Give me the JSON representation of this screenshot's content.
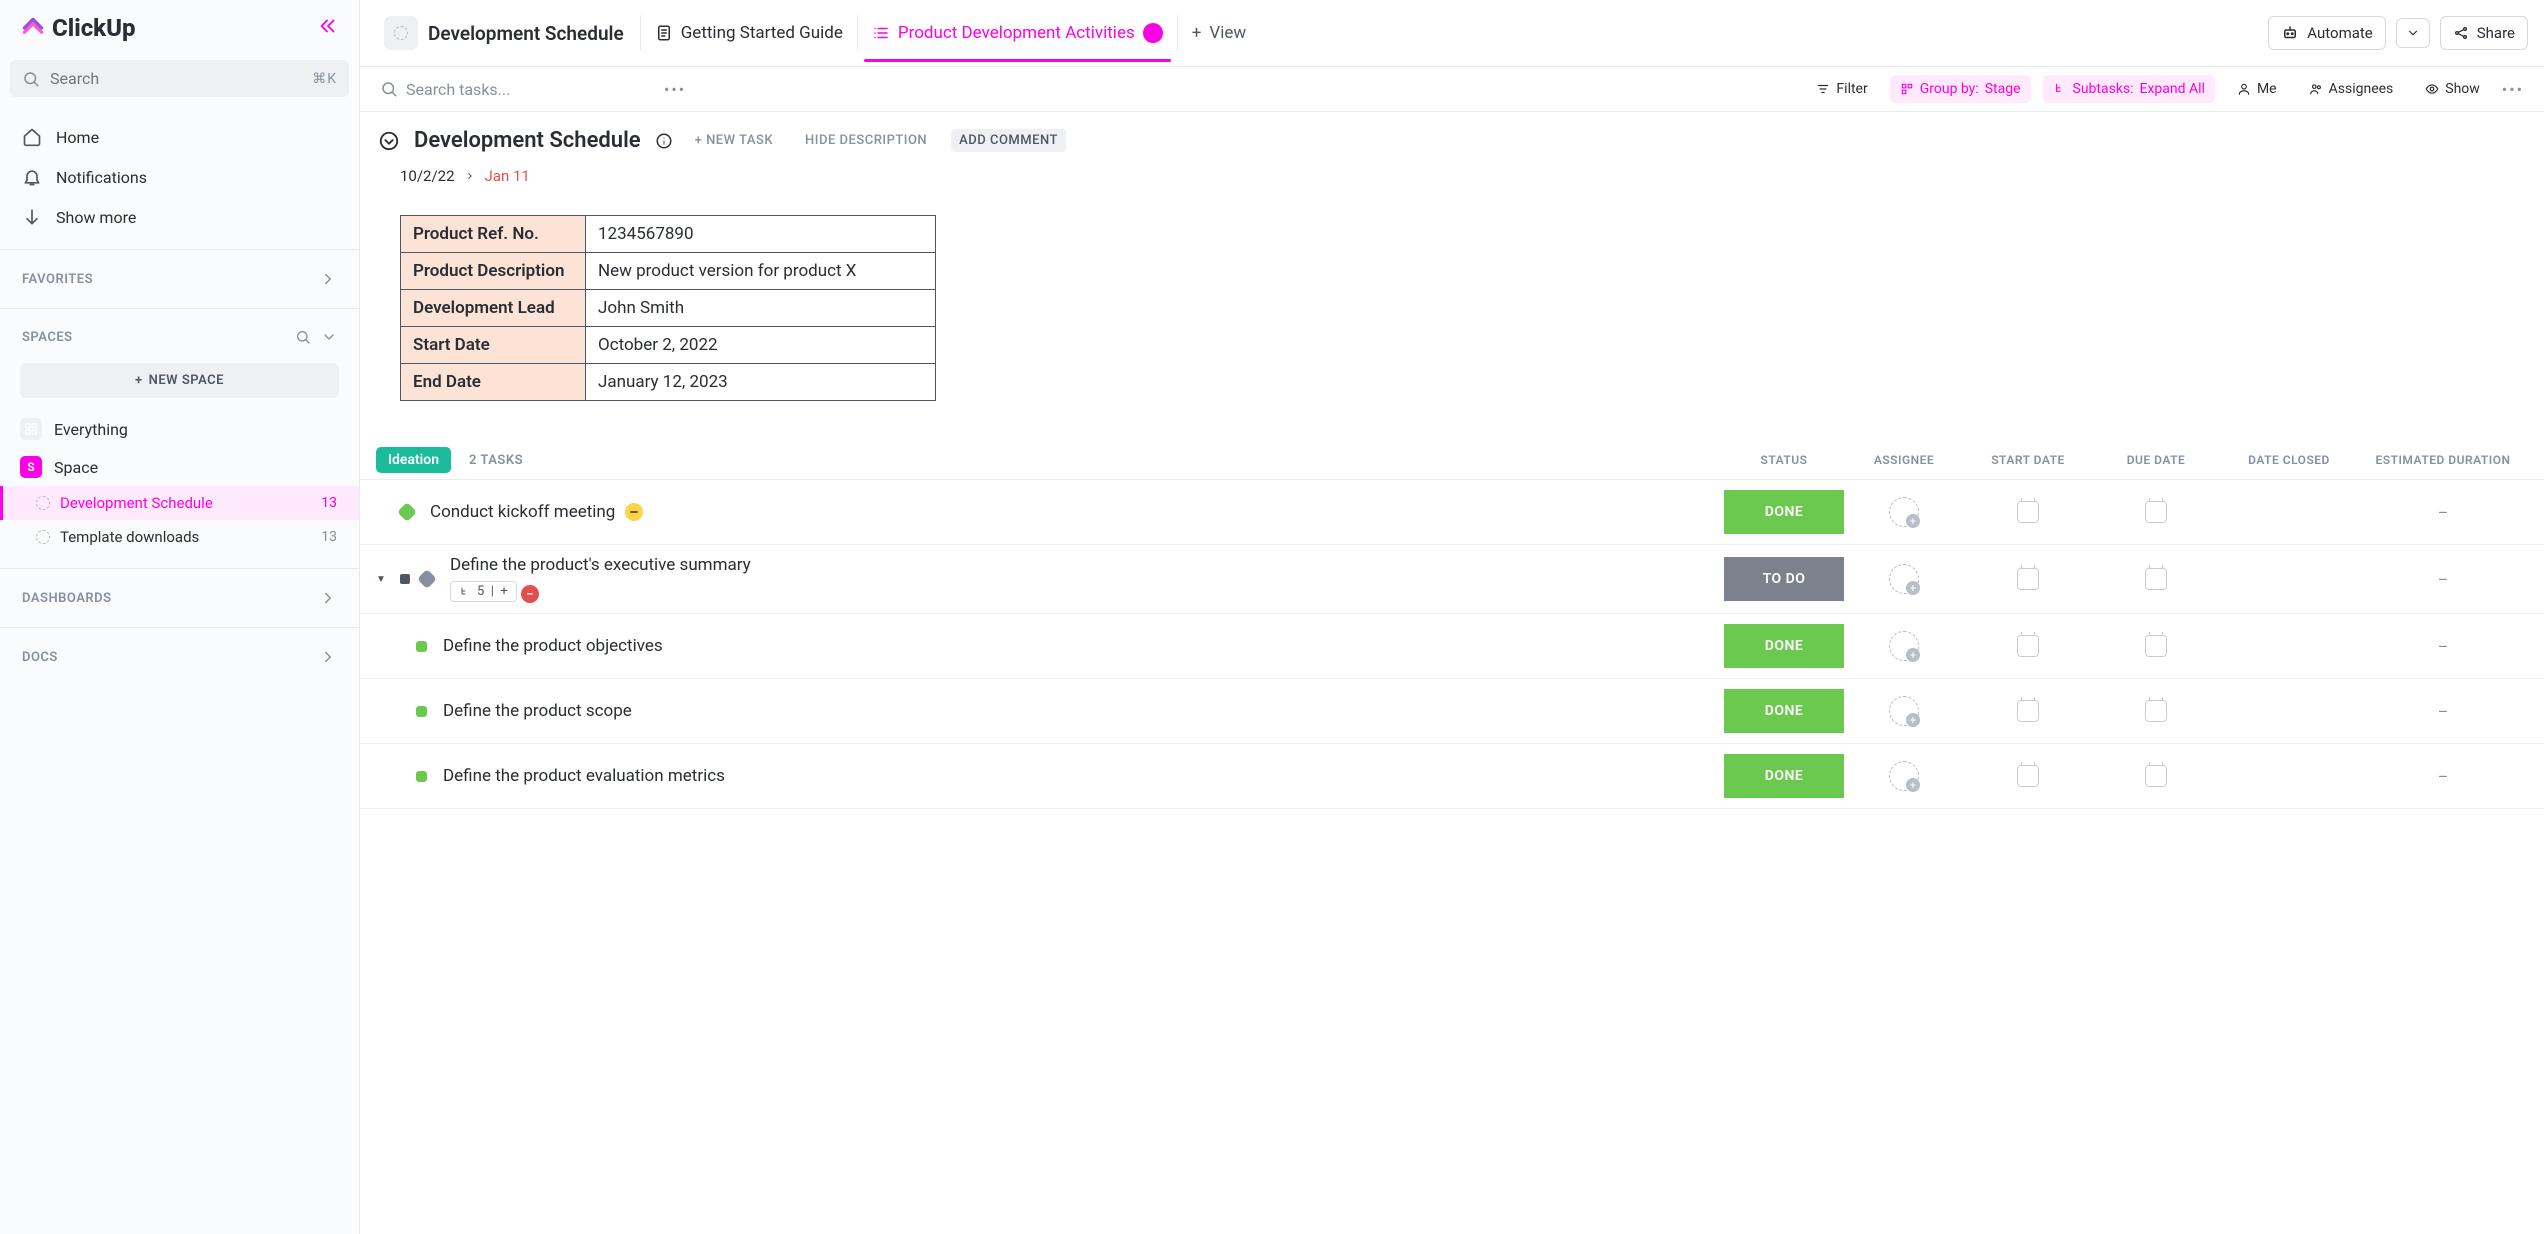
{
  "app": {
    "name": "ClickUp"
  },
  "sidebar": {
    "search_placeholder": "Search",
    "search_kbd": "⌘K",
    "nav": [
      {
        "label": "Home"
      },
      {
        "label": "Notifications"
      },
      {
        "label": "Show more"
      }
    ],
    "favorites_label": "FAVORITES",
    "spaces_label": "SPACES",
    "new_space_label": "NEW SPACE",
    "everything_label": "Everything",
    "space_label": "Space",
    "space_initial": "S",
    "lists": [
      {
        "label": "Development Schedule",
        "count": "13",
        "active": true
      },
      {
        "label": "Template downloads",
        "count": "13",
        "active": false
      }
    ],
    "dashboards_label": "DASHBOARDS",
    "docs_label": "DOCS"
  },
  "topbar": {
    "breadcrumb": "Development Schedule",
    "tabs": [
      {
        "label": "Getting Started Guide",
        "active": false
      },
      {
        "label": "Product Development Activities",
        "active": true
      }
    ],
    "add_view": "View",
    "automate": "Automate",
    "share": "Share"
  },
  "toolbar": {
    "search_placeholder": "Search tasks...",
    "filter": "Filter",
    "group_by_label": "Group by:",
    "group_by_value": "Stage",
    "subtasks_label": "Subtasks:",
    "subtasks_value": "Expand All",
    "me": "Me",
    "assignees": "Assignees",
    "show": "Show"
  },
  "doc": {
    "title": "Development Schedule",
    "new_task": "+ NEW TASK",
    "hide_desc": "HIDE DESCRIPTION",
    "add_comment": "ADD COMMENT",
    "start_date_short": "10/2/22",
    "due_date_short": "Jan 11",
    "info": [
      {
        "label": "Product Ref. No.",
        "value": "1234567890"
      },
      {
        "label": "Product Description",
        "value": "New product version for product X"
      },
      {
        "label": "Development Lead",
        "value": "John Smith"
      },
      {
        "label": "Start Date",
        "value": "October 2, 2022"
      },
      {
        "label": "End Date",
        "value": "January 12, 2023"
      }
    ]
  },
  "group": {
    "name": "Ideation",
    "count": "2 TASKS",
    "columns": {
      "status": "STATUS",
      "assignee": "ASSIGNEE",
      "start": "START DATE",
      "due": "DUE DATE",
      "closed": "DATE CLOSED",
      "est": "ESTIMATED DURATION"
    }
  },
  "tasks": [
    {
      "title": "Conduct kickoff meeting",
      "status": "DONE",
      "status_class": "done",
      "priority": "med",
      "est": "–"
    },
    {
      "title": "Define the product's executive summary",
      "status": "TO DO",
      "status_class": "todo",
      "subtasks": "5",
      "priority_urgent": true,
      "est": "–",
      "expanded": true
    },
    {
      "title": "Define the product objectives",
      "status": "DONE",
      "status_class": "done",
      "sub": true,
      "est": "–"
    },
    {
      "title": "Define the product scope",
      "status": "DONE",
      "status_class": "done",
      "sub": true,
      "est": "–"
    },
    {
      "title": "Define the product evaluation metrics",
      "status": "DONE",
      "status_class": "done",
      "sub": true,
      "est": "–"
    }
  ]
}
